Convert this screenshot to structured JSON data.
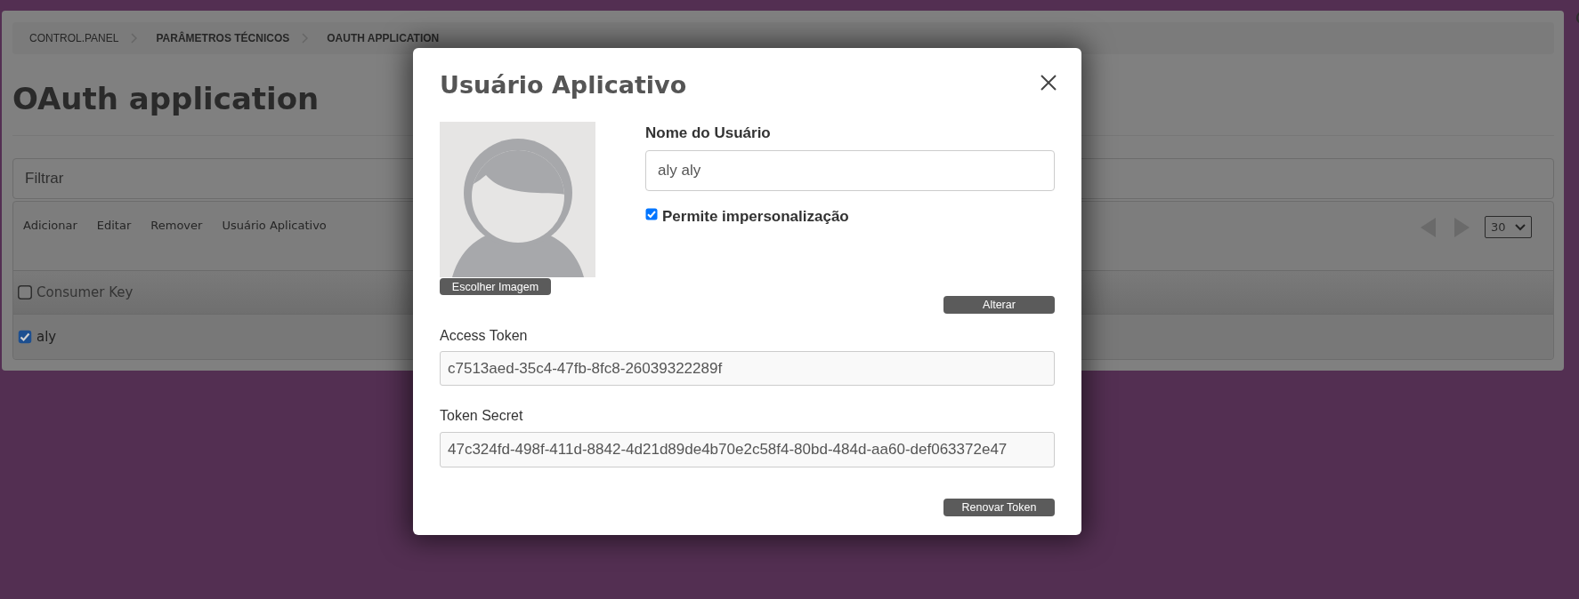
{
  "breadcrumb": [
    {
      "label": "CONTROL.PANEL",
      "kind": "root"
    },
    {
      "label": "PARÂMETROS TÉCNICOS",
      "kind": "section"
    },
    {
      "label": "OAUTH APPLICATION",
      "kind": "section"
    }
  ],
  "page_title": "OAuth application",
  "filter": {
    "placeholder": "Filtrar"
  },
  "toolbar": {
    "actions": [
      "Adicionar",
      "Editar",
      "Remover",
      "Usuário Aplicativo"
    ],
    "pager": {
      "previous": {
        "disabled": true
      },
      "next": {
        "disabled": true
      },
      "page_size": "30"
    }
  },
  "table": {
    "select_all": {
      "checked": false
    },
    "columns": [
      {
        "label": "Consumer Key"
      }
    ],
    "rows": [
      {
        "checked": true,
        "cells": [
          "aly"
        ]
      }
    ]
  },
  "dialog": {
    "title": "Usuário Aplicativo",
    "image_button": "Escolher Imagem",
    "name_field": {
      "label": "Nome do Usuário",
      "value": "aly aly"
    },
    "impersonation": {
      "label": "Permite impersonalização",
      "checked": true
    },
    "update_button": "Alterar",
    "access_token": {
      "label": "Access Token",
      "value": "c7513aed-35c4-47fb-8fc8-26039322289f"
    },
    "token_secret": {
      "label": "Token Secret",
      "value": "47c324fd-498f-411d-8842-4d21d89de4b70e2c58f4-80bd-484d-aa60-def063372e47"
    },
    "renew_button": "Renovar Token"
  }
}
